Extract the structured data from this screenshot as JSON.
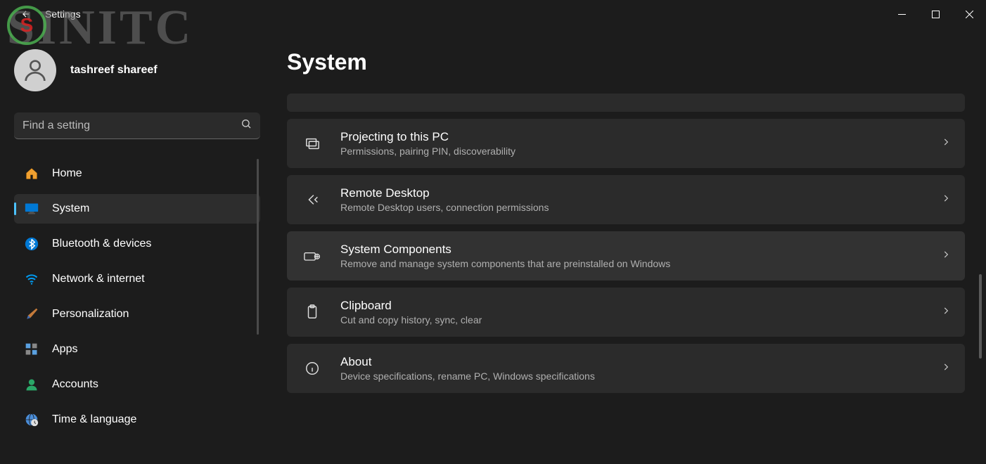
{
  "window": {
    "title": "Settings"
  },
  "watermark": "SINITC",
  "profile": {
    "name": "tashreef shareef"
  },
  "search": {
    "placeholder": "Find a setting"
  },
  "sidebar": {
    "items": [
      {
        "label": "Home"
      },
      {
        "label": "System"
      },
      {
        "label": "Bluetooth & devices"
      },
      {
        "label": "Network & internet"
      },
      {
        "label": "Personalization"
      },
      {
        "label": "Apps"
      },
      {
        "label": "Accounts"
      },
      {
        "label": "Time & language"
      }
    ]
  },
  "page": {
    "title": "System",
    "partial_desc": "",
    "items": [
      {
        "title": "Projecting to this PC",
        "desc": "Permissions, pairing PIN, discoverability"
      },
      {
        "title": "Remote Desktop",
        "desc": "Remote Desktop users, connection permissions"
      },
      {
        "title": "System Components",
        "desc": "Remove and manage system components that are preinstalled on Windows"
      },
      {
        "title": "Clipboard",
        "desc": "Cut and copy history, sync, clear"
      },
      {
        "title": "About",
        "desc": "Device specifications, rename PC, Windows specifications"
      }
    ]
  }
}
